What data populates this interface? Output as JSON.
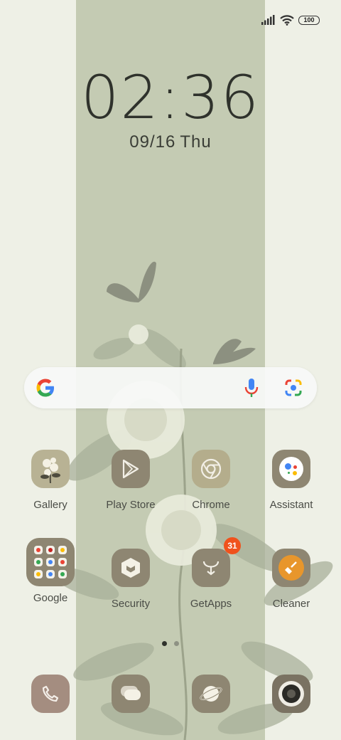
{
  "status_bar": {
    "battery": "100",
    "signal_icon": "signal-icon",
    "wifi_icon": "wifi-icon"
  },
  "lock": {
    "time": "02:36",
    "date": "09/16",
    "weekday": "Thu"
  },
  "search_bar": {
    "google_icon": "google-g-icon",
    "mic_icon": "microphone-icon",
    "lens_icon": "camera-lens-icon"
  },
  "apps": {
    "gallery": {
      "label": "Gallery"
    },
    "play_store": {
      "label": "Play Store"
    },
    "chrome": {
      "label": "Chrome"
    },
    "assistant": {
      "label": "Assistant"
    },
    "google_folder": {
      "label": "Google"
    },
    "security": {
      "label": "Security"
    },
    "getapps": {
      "label": "GetApps",
      "badge": "31"
    },
    "cleaner": {
      "label": "Cleaner"
    }
  },
  "pager": {
    "pages": 2,
    "current": 1
  },
  "dock": [
    "phone-icon",
    "messages-icon",
    "browser-icon",
    "camera-icon"
  ],
  "colors": {
    "background": "#eef0e6",
    "band": "#c4cbb3",
    "icon_beige": "#b4ad8c",
    "icon_taupe": "#8e8672",
    "badge": "#f0521d"
  }
}
